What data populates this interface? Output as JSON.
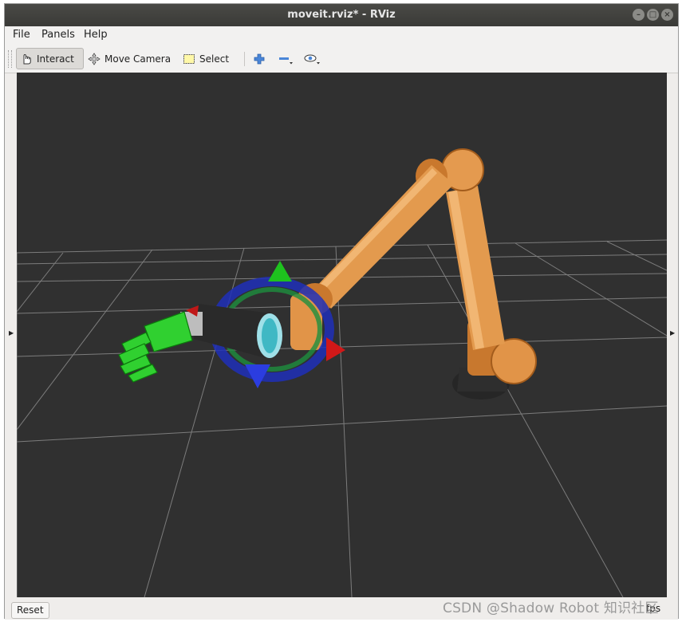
{
  "window": {
    "title": "moveit.rviz* - RViz"
  },
  "menubar": {
    "items": [
      "File",
      "Panels",
      "Help"
    ]
  },
  "toolbar": {
    "interact_label": "Interact",
    "move_camera_label": "Move Camera",
    "select_label": "Select",
    "icons": [
      "hand-pointer-icon",
      "move-camera-icon",
      "select-box-icon",
      "add-tool-icon",
      "remove-tool-icon",
      "view-eye-icon"
    ]
  },
  "statusbar": {
    "reset_label": "Reset",
    "fps_label": "fps"
  },
  "watermark": {
    "text": "CSDN @Shadow Robot 知识社区"
  },
  "colors": {
    "viewport_bg": "#303030",
    "robot_arm": "#d98a3a",
    "hand": "#2fd22f",
    "ring": "#2030c0"
  }
}
